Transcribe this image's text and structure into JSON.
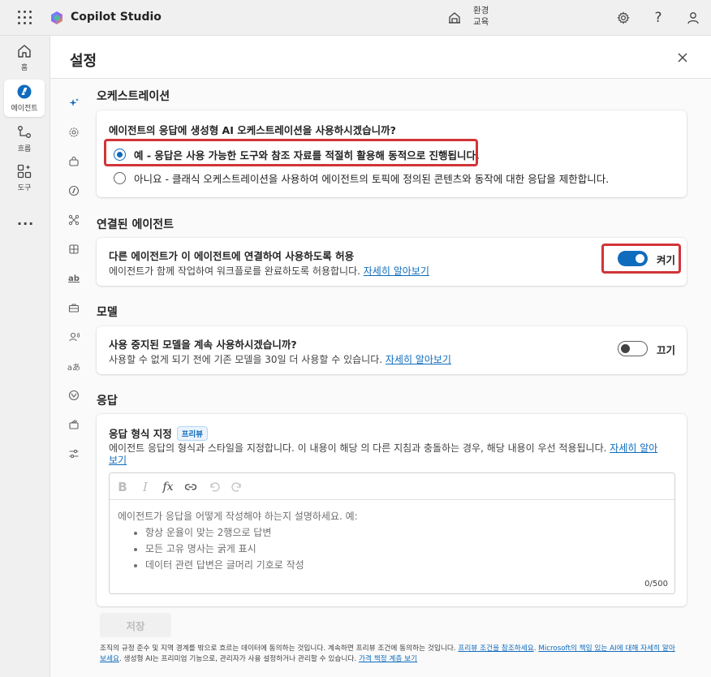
{
  "app": {
    "title": "Copilot Studio"
  },
  "header": {
    "environment_label": "환경",
    "environment_name": "교육"
  },
  "nav": {
    "items": [
      {
        "label": "홈",
        "icon": "home-icon"
      },
      {
        "label": "에이전트",
        "icon": "agent-icon"
      },
      {
        "label": "흐름",
        "icon": "flow-icon"
      },
      {
        "label": "도구",
        "icon": "tools-icon"
      }
    ],
    "more": "···"
  },
  "panel": {
    "title": "설정"
  },
  "orchestration": {
    "section_title": "오케스트레이션",
    "question": "에이전트의 응답에 생성형 AI 오케스트레이션을 사용하시겠습니까?",
    "option_yes": "예 - 응답은 사용 가능한 도구와 참조 자료를 적절히 활용해 동적으로 진행됩니다.",
    "option_no": "아니요 - 클래식 오케스트레이션을 사용하여 에이전트의 토픽에 정의된 콘텐츠와 동작에 대한 응답을 제한합니다."
  },
  "connected_agents": {
    "section_title": "연결된 에이전트",
    "title": "다른 에이전트가 이 에이전트에 연결하여 사용하도록 허용",
    "description": "에이전트가 함께 작업하여 워크플로를 완료하도록 허용합니다.",
    "link": "자세히 알아보기",
    "toggle_label": "켜기",
    "toggle_on": true
  },
  "model": {
    "section_title": "모델",
    "title": "사용 중지된 모델을 계속 사용하시겠습니까?",
    "description": "사용할 수 없게 되기 전에 기존 모델을 30일 더 사용할 수 있습니다.",
    "link": "자세히 알아보기",
    "toggle_label": "끄기",
    "toggle_on": false
  },
  "response": {
    "section_title": "응답",
    "title": "응답 형식 지정",
    "badge": "프리뷰",
    "description": "에이전트 응답의 형식과 스타일을 지정합니다. 이 내용이 해당 의 다른 지침과 충돌하는 경우, 해당 내용이 우선 적용됩니다.",
    "link_part1": "자세히 알아",
    "link_part2": "보기",
    "placeholder_intro": "에이전트가 응답을 어떻게 작성해야 하는지 설명하세요. 예:",
    "placeholder_items": [
      "항상 운율이 맞는 2행으로 답변",
      "모든 고유 명사는 굵게 표시",
      "데이터 관련 답변은 글머리 기호로 작성"
    ],
    "counter": "0/500"
  },
  "save_label": "저장",
  "footer": {
    "text1": "조직의 규정 준수 및 지역 경계를 밖으로 흐르는 데이터에 동의하는 것입니다. 계속하면 프리뷰 조건에 동의하는 것입니다.",
    "link1": "프리뷰 조건을 참조하세요",
    "link2a": "Microsoft의 책임 있는 AI에 대해 자세히 알아",
    "link2b": "보세요",
    "text2": ". 생성형 AI는 프리미엄 기능으로, 관리자가 사용 설정하거나 관리할 수 있습니다.",
    "link3": "가격 책정 계층 보기"
  },
  "colors": {
    "accent": "#0f6cbd",
    "highlight": "#d13438"
  }
}
